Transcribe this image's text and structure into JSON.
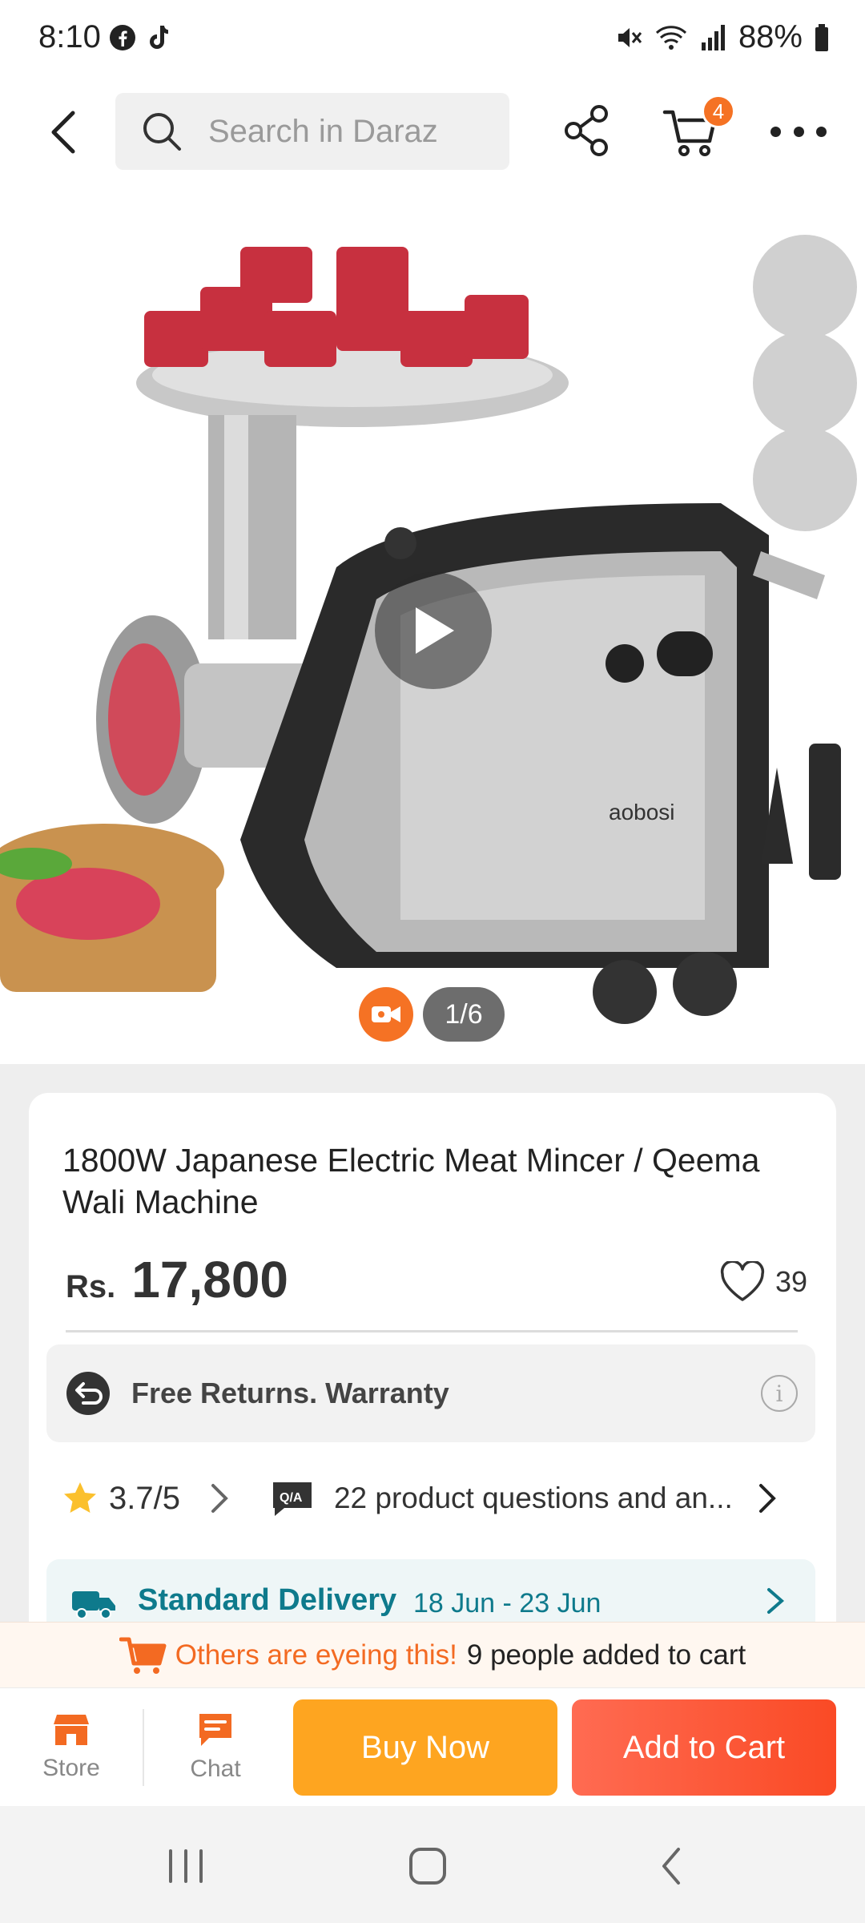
{
  "status_bar": {
    "time": "8:10",
    "battery": "88%"
  },
  "top_bar": {
    "search_placeholder": "Search in Daraz",
    "cart_count": "4"
  },
  "gallery": {
    "page_indicator": "1/6"
  },
  "product": {
    "title": "1800W Japanese Electric Meat Mincer / Qeema Wali Machine",
    "price_currency": "Rs.",
    "price_value": "17,800",
    "favorites_count": "39",
    "returns_text": "Free Returns. Warranty",
    "rating": "3.7/5",
    "qa_text": "22 product questions and an...",
    "delivery_label": "Standard Delivery",
    "delivery_date": "18 Jun - 23 Jun"
  },
  "eyeing": {
    "highlight": "Others are eyeing this!",
    "text": "9 people added to cart"
  },
  "actions": {
    "store_label": "Store",
    "chat_label": "Chat",
    "buy_now_label": "Buy Now",
    "add_to_cart_label": "Add to Cart"
  },
  "colors": {
    "brand_orange": "#f57224",
    "buy_now": "#fea520",
    "add_to_cart": "#fa4a25",
    "delivery_teal": "#0e7a8c"
  }
}
